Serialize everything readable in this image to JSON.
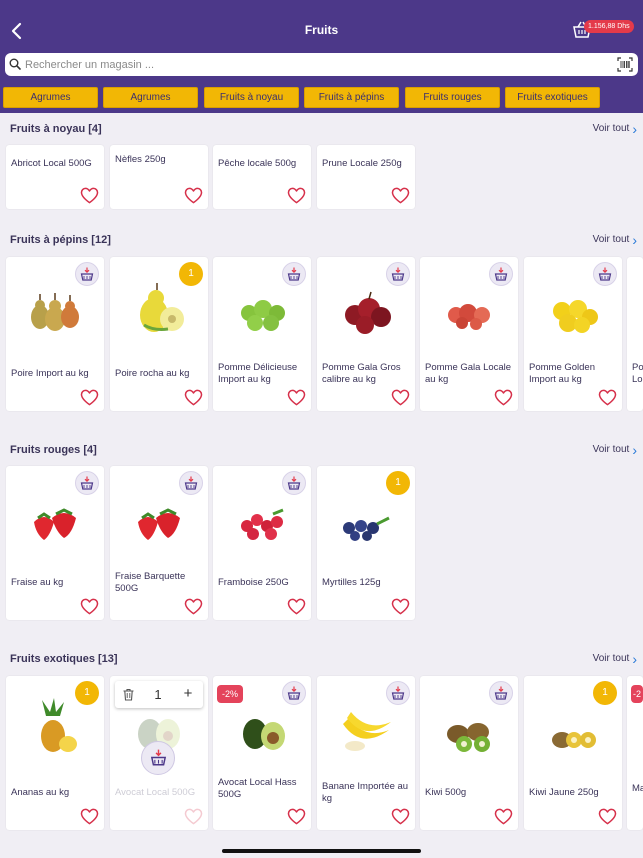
{
  "header": {
    "title": "Fruits",
    "cart_total": "1.156,88 Dhs"
  },
  "search": {
    "placeholder": "Rechercher un magasin ..."
  },
  "chips": [
    "Agrumes",
    "Agrumes",
    "Fruits à noyau",
    "Fruits à pépins",
    "Fruits rouges",
    "Fruits exotiques"
  ],
  "see_all_label": "Voir tout",
  "sections": [
    {
      "title": "Fruits à noyau [4]",
      "products": [
        {
          "name": "Abricot Local 500G"
        },
        {
          "name": "Nèfles 250g"
        },
        {
          "name": "Pêche locale 500g"
        },
        {
          "name": "Prune Locale 250g"
        }
      ]
    },
    {
      "title": "Fruits à pépins [12]",
      "products": [
        {
          "name": "Poire Import au kg",
          "fruit": "pear"
        },
        {
          "name": "Poire rocha au kg",
          "fruit": "pear-yellow",
          "in_cart_qty": "1"
        },
        {
          "name": "Pomme Délicieuse Import au kg",
          "fruit": "apple-green"
        },
        {
          "name": "Pomme Gala Gros calibre au kg",
          "fruit": "apple-red-dark"
        },
        {
          "name": "Pomme Gala Locale au kg",
          "fruit": "apple-red"
        },
        {
          "name": "Pomme Golden Import au kg",
          "fruit": "apple-yellow"
        }
      ],
      "overflow_text": "Po Lo"
    },
    {
      "title": "Fruits rouges [4]",
      "products": [
        {
          "name": "Fraise au kg",
          "fruit": "strawberry"
        },
        {
          "name": "Fraise Barquette 500G",
          "fruit": "strawberry"
        },
        {
          "name": "Framboise 250G",
          "fruit": "raspberry"
        },
        {
          "name": "Myrtilles 125g",
          "fruit": "blueberry",
          "in_cart_qty": "1"
        }
      ]
    },
    {
      "title": "Fruits exotiques [13]",
      "products": [
        {
          "name": "Ananas au kg",
          "fruit": "pineapple",
          "in_cart_qty": "1"
        },
        {
          "name": "Avocat Local 500G",
          "fruit": "avocado-faded"
        },
        {
          "name": "Avocat Local Hass 500G",
          "fruit": "avocado",
          "promo": "-2%"
        },
        {
          "name": "Banane Importée au kg",
          "fruit": "banana"
        },
        {
          "name": "Kiwi 500g",
          "fruit": "kiwi"
        },
        {
          "name": "Kiwi Jaune 250g",
          "fruit": "kiwi-yellow",
          "in_cart_qty": "1"
        }
      ],
      "overflow_text": "Ma",
      "overflow_promo": "-2"
    }
  ],
  "stepper": {
    "quantity": "1",
    "plus": "+"
  },
  "colors": {
    "brand": "#4c3889",
    "chip": "#f2b705",
    "heart": "#d6304a",
    "link": "#2a7ad8"
  }
}
